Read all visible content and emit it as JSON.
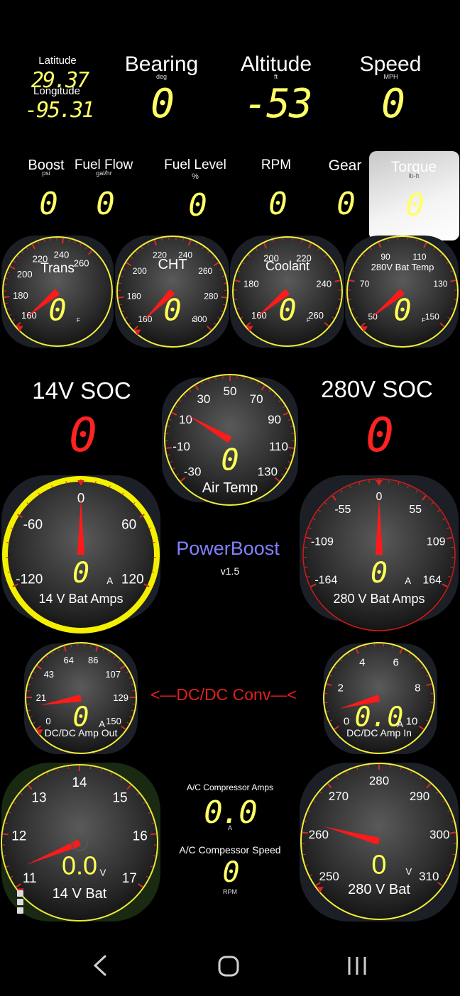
{
  "header": {
    "latitude_label": "Latitude",
    "latitude_value": "29.37",
    "longitude_label": "Longitude",
    "longitude_value": "-95.31",
    "bearing_label": "Bearing",
    "bearing_unit": "deg",
    "bearing_value": "0",
    "altitude_label": "Altitude",
    "altitude_unit": "ft",
    "altitude_value": "-53",
    "speed_label": "Speed",
    "speed_unit": "MPH",
    "speed_value": "0"
  },
  "row2": [
    {
      "label": "Boost",
      "unit": "psi",
      "value": "0"
    },
    {
      "label": "Fuel Flow",
      "unit": "gal/hr",
      "value": "0"
    },
    {
      "label": "Fuel Level",
      "unit": "%",
      "value": "0"
    },
    {
      "label": "RPM",
      "unit": "",
      "value": "0"
    },
    {
      "label": "Gear",
      "unit": "",
      "value": "0"
    },
    {
      "label": "Torque",
      "unit": "lb-ft",
      "value": "0"
    }
  ],
  "gauges": {
    "trans": {
      "title": "Trans",
      "ticks": [
        "160",
        "180",
        "200",
        "220",
        "240",
        "260"
      ],
      "value": "0",
      "unit": "F",
      "level": 0
    },
    "cht": {
      "title": "CHT",
      "ticks": [
        "160",
        "180",
        "200",
        "220",
        "240",
        "260",
        "280",
        "300"
      ],
      "value": "0",
      "unit": "F",
      "level": 0
    },
    "coolant": {
      "title": "Coolant",
      "ticks": [
        "160",
        "180",
        "200",
        "220",
        "240",
        "260"
      ],
      "value": "0",
      "unit": "F",
      "level": 0
    },
    "bat280temp": {
      "title": "280V Bat Temp",
      "ticks": [
        "50",
        "70",
        "90",
        "110",
        "130",
        "150"
      ],
      "value": "0",
      "unit": "F",
      "level": 0
    },
    "airtemp": {
      "title": "Air Temp",
      "ticks": [
        "-30",
        "-10",
        "10",
        "30",
        "50",
        "70",
        "90",
        "110",
        "130"
      ],
      "value": "0",
      "level": 0.27
    },
    "amps14": {
      "title": "14 V Bat Amps",
      "ticks": [
        "-120",
        "-60",
        "0",
        "60",
        "120"
      ],
      "value": "0",
      "unit": "A",
      "level": 0.5
    },
    "amps280": {
      "title": "280 V Bat Amps",
      "ticks": [
        "-164",
        "-109",
        "-55",
        "0",
        "55",
        "109",
        "164"
      ],
      "value": "0",
      "unit": "A",
      "level": 0.5
    },
    "dcout": {
      "title": "DC/DC Amp Out",
      "ticks": [
        "0",
        "21",
        "43",
        "64",
        "86",
        "107",
        "129",
        "150"
      ],
      "value": "0",
      "unit": "A",
      "level": 0.1
    },
    "dcin": {
      "title": "DC/DC Amp In",
      "ticks": [
        "0",
        "2",
        "4",
        "6",
        "8",
        "10"
      ],
      "value": "0.0",
      "unit": "A",
      "level": 0.08
    },
    "bat14": {
      "title": "14 V Bat",
      "ticks": [
        "11",
        "12",
        "13",
        "14",
        "15",
        "16",
        "17"
      ],
      "value": "0.0",
      "unit": "V",
      "level": 0.05
    },
    "bat280": {
      "title": "280 V Bat",
      "ticks": [
        "250",
        "260",
        "270",
        "280",
        "290",
        "300",
        "310"
      ],
      "value": "0",
      "unit": "V",
      "level": 0.2
    }
  },
  "soc14": {
    "label": "14V SOC",
    "value": "0"
  },
  "soc280": {
    "label": "280V SOC",
    "value": "0"
  },
  "brand": {
    "name": "PowerBoost",
    "version": "v1.5"
  },
  "dcconv_label": "<—DC/DC  Conv—<",
  "ac": {
    "amps_label": "A/C Compressor  Amps",
    "amps_value": "0.0",
    "amps_unit": "A",
    "speed_label": "A/C Compessor Speed",
    "speed_value": "0",
    "speed_unit": "RPM"
  },
  "colors": {
    "digit_yellow": "#ffff66",
    "digit_red": "#ff2222",
    "needle": "#ff1a1a",
    "ring_yellow": "#f2ef3a",
    "brand": "#8080ff"
  }
}
